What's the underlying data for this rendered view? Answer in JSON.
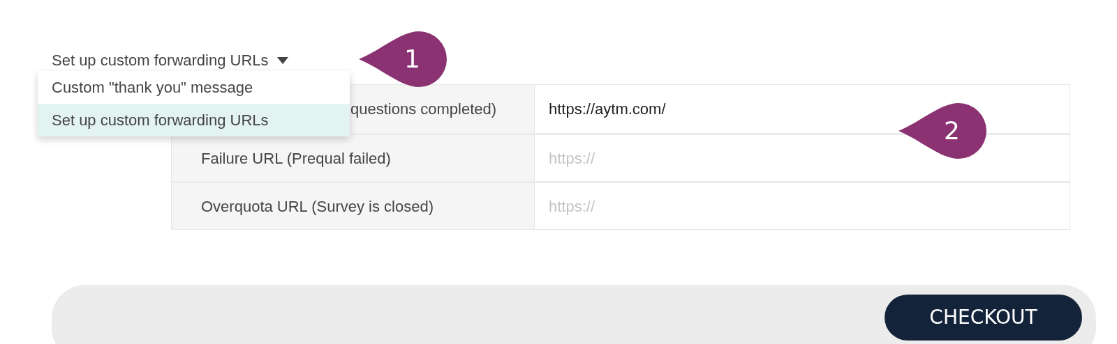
{
  "dropdown": {
    "label": "Set up custom forwarding URLs",
    "expanded": true,
    "options": [
      {
        "label": "Custom \"thank you\" message",
        "selected": false
      },
      {
        "label": "Set up custom forwarding URLs",
        "selected": true
      }
    ]
  },
  "url_table": {
    "rows": [
      {
        "kind": "covered",
        "label": "questions completed)",
        "value": "https://aytm.com/"
      },
      {
        "kind": "plain",
        "label": "Failure URL (Prequal failed)",
        "placeholder": "https://"
      },
      {
        "kind": "plain",
        "label": "Overquota URL (Survey is closed)",
        "placeholder": "https://"
      }
    ]
  },
  "callouts": [
    "1",
    "2"
  ],
  "footer": {
    "button": "CHECKOUT"
  }
}
